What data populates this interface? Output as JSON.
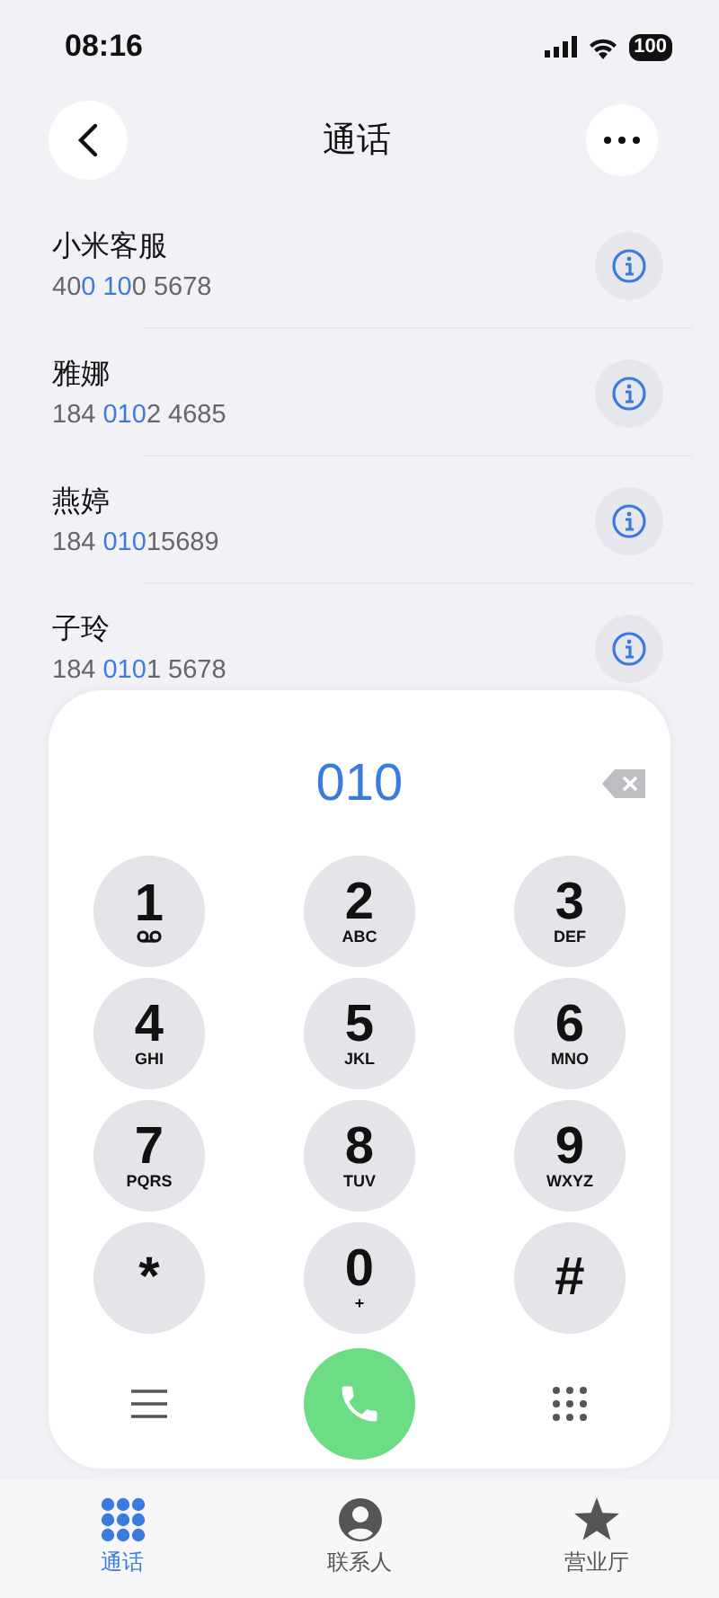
{
  "status_bar": {
    "time": "08:16",
    "battery": "100"
  },
  "header": {
    "title": "通话"
  },
  "contacts": [
    {
      "name": "小米客服",
      "number_parts": [
        {
          "text": "40",
          "highlight": false
        },
        {
          "text": "0 10",
          "highlight": true
        },
        {
          "text": "0 5678",
          "highlight": false
        }
      ]
    },
    {
      "name": "雅娜",
      "number_parts": [
        {
          "text": "184 ",
          "highlight": false
        },
        {
          "text": "010",
          "highlight": true
        },
        {
          "text": "2 4685",
          "highlight": false
        }
      ]
    },
    {
      "name": "燕婷",
      "number_parts": [
        {
          "text": "184 ",
          "highlight": false
        },
        {
          "text": "010",
          "highlight": true
        },
        {
          "text": "15689",
          "highlight": false
        }
      ]
    },
    {
      "name": "子玲",
      "number_parts": [
        {
          "text": "184 ",
          "highlight": false
        },
        {
          "text": "010",
          "highlight": true
        },
        {
          "text": "1 5678",
          "highlight": false
        }
      ]
    }
  ],
  "dialpad": {
    "entered": "010",
    "keys": [
      {
        "digit": "1",
        "kind": "voicemail"
      },
      {
        "digit": "2",
        "letters": "ABC",
        "kind": "letters"
      },
      {
        "digit": "3",
        "letters": "DEF",
        "kind": "letters"
      },
      {
        "digit": "4",
        "letters": "GHI",
        "kind": "letters"
      },
      {
        "digit": "5",
        "letters": "JKL",
        "kind": "letters"
      },
      {
        "digit": "6",
        "letters": "MNO",
        "kind": "letters"
      },
      {
        "digit": "7",
        "letters": "PQRS",
        "kind": "letters"
      },
      {
        "digit": "8",
        "letters": "TUV",
        "kind": "letters"
      },
      {
        "digit": "9",
        "letters": "WXYZ",
        "kind": "letters"
      },
      {
        "digit": "*",
        "kind": "symbol"
      },
      {
        "digit": "0",
        "letters": "+",
        "kind": "letters"
      },
      {
        "digit": "#",
        "kind": "symbol"
      }
    ]
  },
  "tabs": [
    {
      "label": "通话",
      "selected": true
    },
    {
      "label": "联系人",
      "selected": false
    },
    {
      "label": "营业厅",
      "selected": false
    }
  ]
}
